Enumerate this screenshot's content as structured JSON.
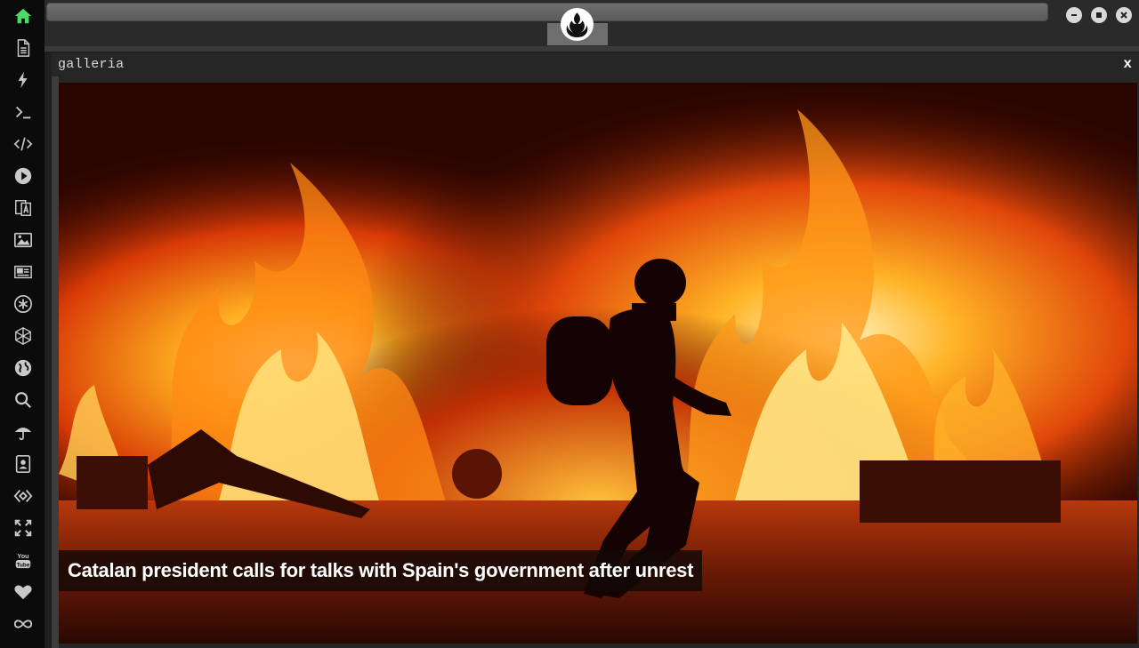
{
  "panel": {
    "title": "galleria",
    "close_label": "x"
  },
  "gallery": {
    "caption": "Catalan president calls for talks with Spain's government after unrest"
  },
  "sidebar": {
    "items": [
      {
        "name": "home-icon",
        "active": true
      },
      {
        "name": "document-icon"
      },
      {
        "name": "lightning-icon"
      },
      {
        "name": "terminal-icon",
        "label": ">_"
      },
      {
        "name": "code-icon",
        "label": "</>"
      },
      {
        "name": "play-icon"
      },
      {
        "name": "translate-icon"
      },
      {
        "name": "image-icon"
      },
      {
        "name": "news-icon"
      },
      {
        "name": "asterisk-icon"
      },
      {
        "name": "hexagon-icon"
      },
      {
        "name": "globe-icon"
      },
      {
        "name": "search-icon"
      },
      {
        "name": "umbrella-icon"
      },
      {
        "name": "contact-icon"
      },
      {
        "name": "diamond-code-icon"
      },
      {
        "name": "expand-icon"
      },
      {
        "name": "youtube-icon",
        "label": "You Tube"
      },
      {
        "name": "heart-icon"
      },
      {
        "name": "infinity-icon"
      }
    ]
  },
  "colors": {
    "sidebar_bg": "#0b0b0b",
    "icon": "#c9c9c9",
    "home_active": "#4cd964",
    "panel_bg": "#262626",
    "caption_text": "#ffffff"
  }
}
